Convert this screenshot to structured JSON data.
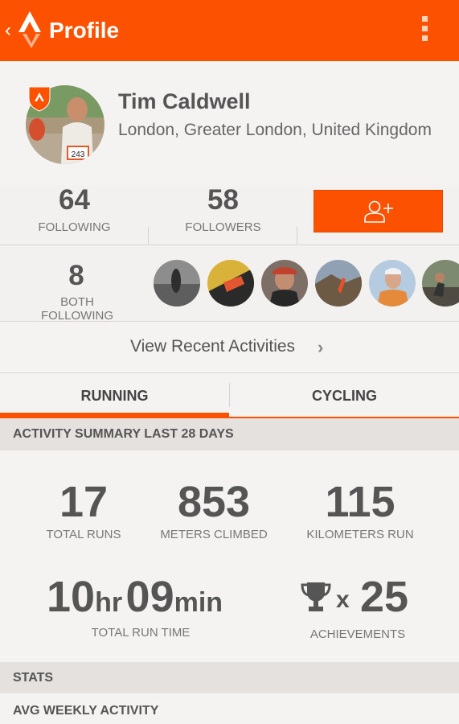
{
  "appbar": {
    "title": "Profile",
    "back_glyph": "‹"
  },
  "profile": {
    "name": "Tim Caldwell",
    "location": "London, Greater London, United Kingdom"
  },
  "counts": {
    "following": {
      "value": "64",
      "label": "FOLLOWING"
    },
    "followers": {
      "value": "58",
      "label": "FOLLOWERS"
    }
  },
  "both_following": {
    "value": "8",
    "label": "BOTH FOLLOWING"
  },
  "recent": {
    "label": "View Recent Activities",
    "chevron": "›"
  },
  "tabs": [
    {
      "label": "RUNNING"
    },
    {
      "label": "CYCLING"
    }
  ],
  "summary": {
    "header": "ACTIVITY SUMMARY LAST 28 DAYS",
    "total_runs": {
      "value": "17",
      "label": "TOTAL RUNS"
    },
    "meters_climbed": {
      "value": "853",
      "label": "METERS CLIMBED"
    },
    "kilometers_run": {
      "value": "115",
      "label": "KILOMETERS RUN"
    },
    "run_time": {
      "hours": "10",
      "hours_unit": "hr",
      "minutes": "09",
      "minutes_unit": "min",
      "label": "TOTAL RUN TIME"
    },
    "achievements": {
      "x": "x",
      "value": "25",
      "label": "ACHIEVEMENTS"
    }
  },
  "stats": {
    "header": "STATS",
    "avg_weekly": "AVG WEEKLY ACTIVITY"
  },
  "icons": {
    "back": "chevron-left-icon",
    "logo": "strava-logo",
    "menu": "overflow-menu-icon",
    "follow": "add-person-icon",
    "trophy": "trophy-icon",
    "badge": "premium-shield-icon"
  },
  "colors": {
    "accent": "#fc5200",
    "background": "#f3f1ef",
    "section": "#e4e1de",
    "text": "#555555"
  }
}
